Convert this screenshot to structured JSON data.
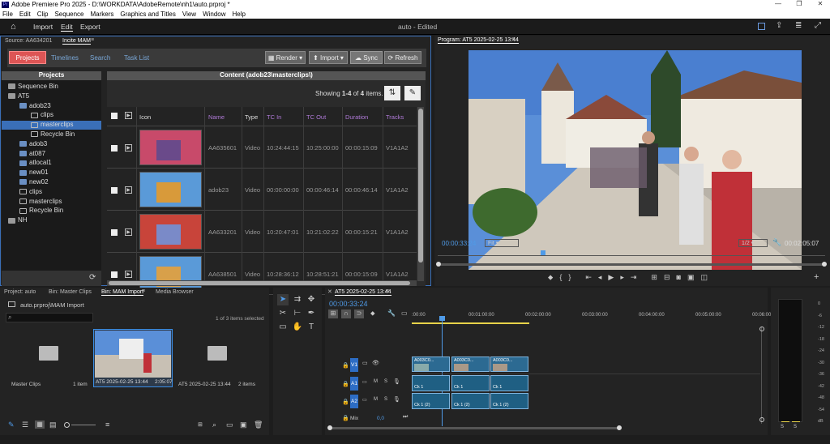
{
  "window": {
    "title": "Adobe Premiere Pro 2025 - D:\\WORKDATA\\AdobeRemote\\nh1\\auto.prproj *"
  },
  "menu": [
    "File",
    "Edit",
    "Clip",
    "Sequence",
    "Markers",
    "Graphics and Titles",
    "View",
    "Window",
    "Help"
  ],
  "topbar": {
    "import": "Import",
    "edit": "Edit",
    "export": "Export",
    "project_status": "auto - Edited"
  },
  "source": {
    "tab1": "Source: AA634201",
    "tab2": "Incite MAM"
  },
  "mam": {
    "tabs": [
      "Projects",
      "Timelines",
      "Search",
      "Task List"
    ],
    "render": "Render",
    "import": "Import",
    "sync": "Sync",
    "refresh": "Refresh",
    "projects_header": "Projects",
    "content_header": "Content (adob23\\masterclips\\)",
    "showing": "Showing",
    "range": "1-4",
    "of": "of",
    "count": "4",
    "items": "items.",
    "tree": [
      {
        "label": "Sequence Bin"
      },
      {
        "label": "AT5"
      },
      {
        "label": "adob23"
      },
      {
        "label": "clips"
      },
      {
        "label": "masterclips"
      },
      {
        "label": "Recycle Bin"
      },
      {
        "label": "adob3"
      },
      {
        "label": "at087"
      },
      {
        "label": "atlocal1"
      },
      {
        "label": "new01"
      },
      {
        "label": "new02"
      },
      {
        "label": "clips"
      },
      {
        "label": "masterclips"
      },
      {
        "label": "Recycle Bin"
      },
      {
        "label": "NH"
      }
    ],
    "columns": [
      "Icon",
      "Name",
      "Type",
      "TC In",
      "TC Out",
      "Duration",
      "Tracks"
    ],
    "rows": [
      {
        "name": "AA635601",
        "type": "Video",
        "tc_in": "10:24:44:15",
        "tc_out": "10:25:00:00",
        "duration": "00:00:15:09",
        "tracks": "V1A1A2"
      },
      {
        "name": "adob23",
        "type": "Video",
        "tc_in": "00:00:00:00",
        "tc_out": "00:00:46:14",
        "duration": "00:00:46:14",
        "tracks": "V1A1A2"
      },
      {
        "name": "AA633201",
        "type": "Video",
        "tc_in": "10:20:47:01",
        "tc_out": "10:21:02:22",
        "duration": "00:00:15:21",
        "tracks": "V1A1A2"
      },
      {
        "name": "AA638501",
        "type": "Video",
        "tc_in": "10:28:36:12",
        "tc_out": "10:28:51:21",
        "duration": "00:00:15:09",
        "tracks": "V1A1A2"
      }
    ]
  },
  "program": {
    "title": "Program: AT5 2025-02-25 13:44",
    "timecode": "00:00:33:24",
    "fit": "Fit",
    "quality": "1/2",
    "duration": "00:02:05:07"
  },
  "project": {
    "tabs": [
      "Project: auto",
      "Bin: Master Clips",
      "Bin: MAM Import",
      "Media Browser"
    ],
    "path": "auto.prproj\\MAM Import",
    "selected": "1 of 3 items selected",
    "items": [
      {
        "name": "Master Clips",
        "meta": "1 item"
      },
      {
        "name": "AT5 2025-02-25 13:44",
        "meta": "2:05:07"
      },
      {
        "name": "AT5 2025-02-25 13:44",
        "meta": "2 items"
      }
    ]
  },
  "timeline": {
    "tab": "AT5 2025-02-25 13:44",
    "timecode": "00:00:33:24",
    "ruler": [
      ":00:00",
      "00:01:00:00",
      "00:02:00:00",
      "00:03:00:00",
      "00:04:00:00",
      "00:05:00:00",
      "00:06:00:0"
    ],
    "tracks": {
      "v1": "V1",
      "a1": "A1",
      "a2": "A2",
      "mix": "Mix",
      "mix_value": "0,0"
    },
    "clips": {
      "video": [
        "A003C0...",
        "A003C0...",
        "A003C0..."
      ],
      "audio": "Ck 1",
      "audio2": "Ck 1 (2)"
    }
  },
  "meter": {
    "scale": [
      "0",
      "-6",
      "-12",
      "-18",
      "-24",
      "-30",
      "-36",
      "-42",
      "-48",
      "-54",
      "dB"
    ],
    "ch": [
      "S",
      "S"
    ]
  }
}
